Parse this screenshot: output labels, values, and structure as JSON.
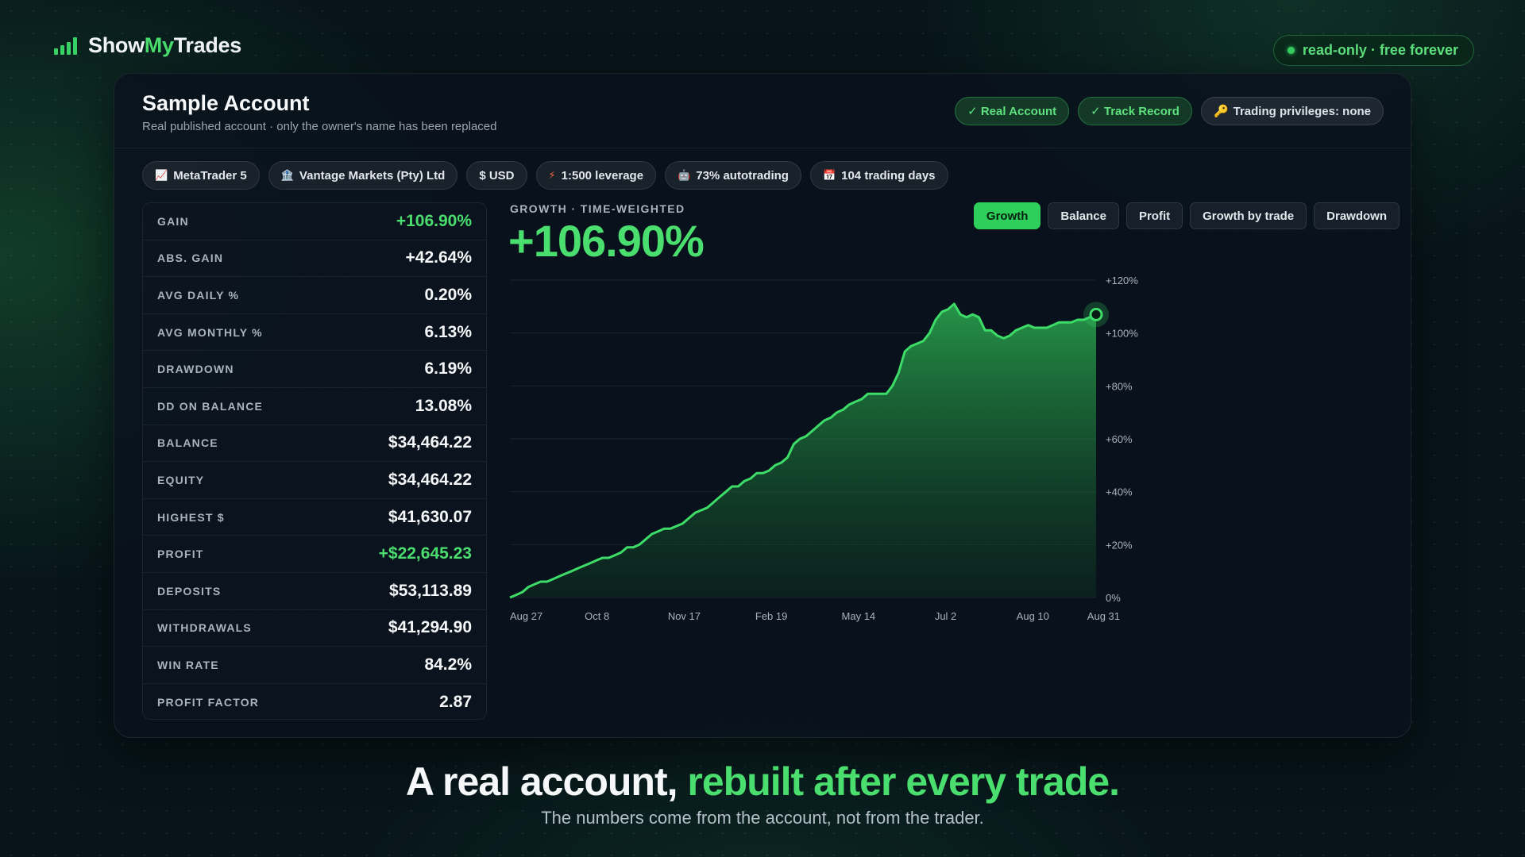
{
  "brand": {
    "name_part1": "Show",
    "name_accent": "My",
    "name_part2": "Trades",
    "icon": "bar-chart-icon"
  },
  "top_pill": {
    "text": "read-only · free forever"
  },
  "account": {
    "title": "Sample Account",
    "subtitle": "Real published account · only the owner's name has been replaced",
    "badges": [
      {
        "label": "✓ Real Account",
        "style": "green"
      },
      {
        "label": "✓ Track Record",
        "style": "green"
      },
      {
        "label": "Trading privileges: none",
        "icon": "🔑",
        "style": "gray"
      }
    ],
    "chips": [
      {
        "icon": "📈",
        "label": "MetaTrader 5"
      },
      {
        "icon": "🏦",
        "label": "Vantage Markets (Pty) Ltd"
      },
      {
        "icon": "",
        "label": "$ USD"
      },
      {
        "icon": "⚡",
        "label": "1:500 leverage"
      },
      {
        "icon": "🤖",
        "label": "73% autotrading"
      },
      {
        "icon": "📅",
        "label": "104 trading days"
      }
    ]
  },
  "stats": [
    {
      "label": "GAIN",
      "value": "+106.90%",
      "positive": true
    },
    {
      "label": "ABS. GAIN",
      "value": "+42.64%",
      "positive": false
    },
    {
      "label": "AVG DAILY %",
      "value": "0.20%",
      "positive": false
    },
    {
      "label": "AVG MONTHLY %",
      "value": "6.13%",
      "positive": false
    },
    {
      "label": "DRAWDOWN",
      "value": "6.19%",
      "positive": false
    },
    {
      "label": "DD ON BALANCE",
      "value": "13.08%",
      "positive": false
    },
    {
      "label": "BALANCE",
      "value": "$34,464.22",
      "positive": false
    },
    {
      "label": "EQUITY",
      "value": "$34,464.22",
      "positive": false
    },
    {
      "label": "HIGHEST $",
      "value": "$41,630.07",
      "positive": false
    },
    {
      "label": "PROFIT",
      "value": "+$22,645.23",
      "positive": true
    },
    {
      "label": "DEPOSITS",
      "value": "$53,113.89",
      "positive": false
    },
    {
      "label": "WITHDRAWALS",
      "value": "$41,294.90",
      "positive": false
    },
    {
      "label": "WIN RATE",
      "value": "84.2%",
      "positive": false
    },
    {
      "label": "PROFIT FACTOR",
      "value": "2.87",
      "positive": false
    }
  ],
  "growth": {
    "label": "GROWTH · TIME-WEIGHTED",
    "value": "+106.90%"
  },
  "tabs": [
    {
      "label": "Growth",
      "active": true
    },
    {
      "label": "Balance",
      "active": false
    },
    {
      "label": "Profit",
      "active": false
    },
    {
      "label": "Growth by trade",
      "active": false
    },
    {
      "label": "Drawdown",
      "active": false
    }
  ],
  "chart_data": {
    "type": "area",
    "title": "",
    "xlabel": "",
    "ylabel": "",
    "ylim": [
      0,
      120
    ],
    "y_ticks": [
      "0%",
      "+20%",
      "+40%",
      "+60%",
      "+80%",
      "+100%",
      "+120%"
    ],
    "x_ticks": [
      "Aug 27",
      "Oct 8",
      "Nov 17",
      "Feb 19",
      "May 14",
      "Jul 2",
      "Aug 10",
      "Aug 31"
    ],
    "grid": true,
    "line_color": "#3ddc68",
    "series": [
      {
        "values": [
          0,
          1,
          2,
          4,
          5,
          6,
          6,
          7,
          8,
          9,
          10,
          11,
          12,
          13,
          14,
          15,
          15,
          16,
          17,
          19,
          19,
          20,
          22,
          24,
          25,
          26,
          26,
          27,
          28,
          30,
          32,
          33,
          34,
          36,
          38,
          40,
          42,
          42,
          44,
          45,
          47,
          47,
          48,
          50,
          51,
          53,
          58,
          60,
          61,
          63,
          65,
          67,
          68,
          70,
          71,
          73,
          74,
          75,
          77,
          77,
          77,
          77,
          80,
          85,
          93,
          95,
          96,
          97,
          100,
          105,
          108,
          109,
          111,
          107,
          106,
          107,
          106,
          101,
          101,
          99,
          98,
          99,
          101,
          102,
          103,
          102,
          102,
          102,
          103,
          104,
          104,
          104,
          105,
          105,
          106,
          107
        ]
      }
    ]
  },
  "tagline": {
    "part1": "A real account, ",
    "highlight": "rebuilt after every trade."
  },
  "subtagline": "The numbers come from the account, not from the trader."
}
